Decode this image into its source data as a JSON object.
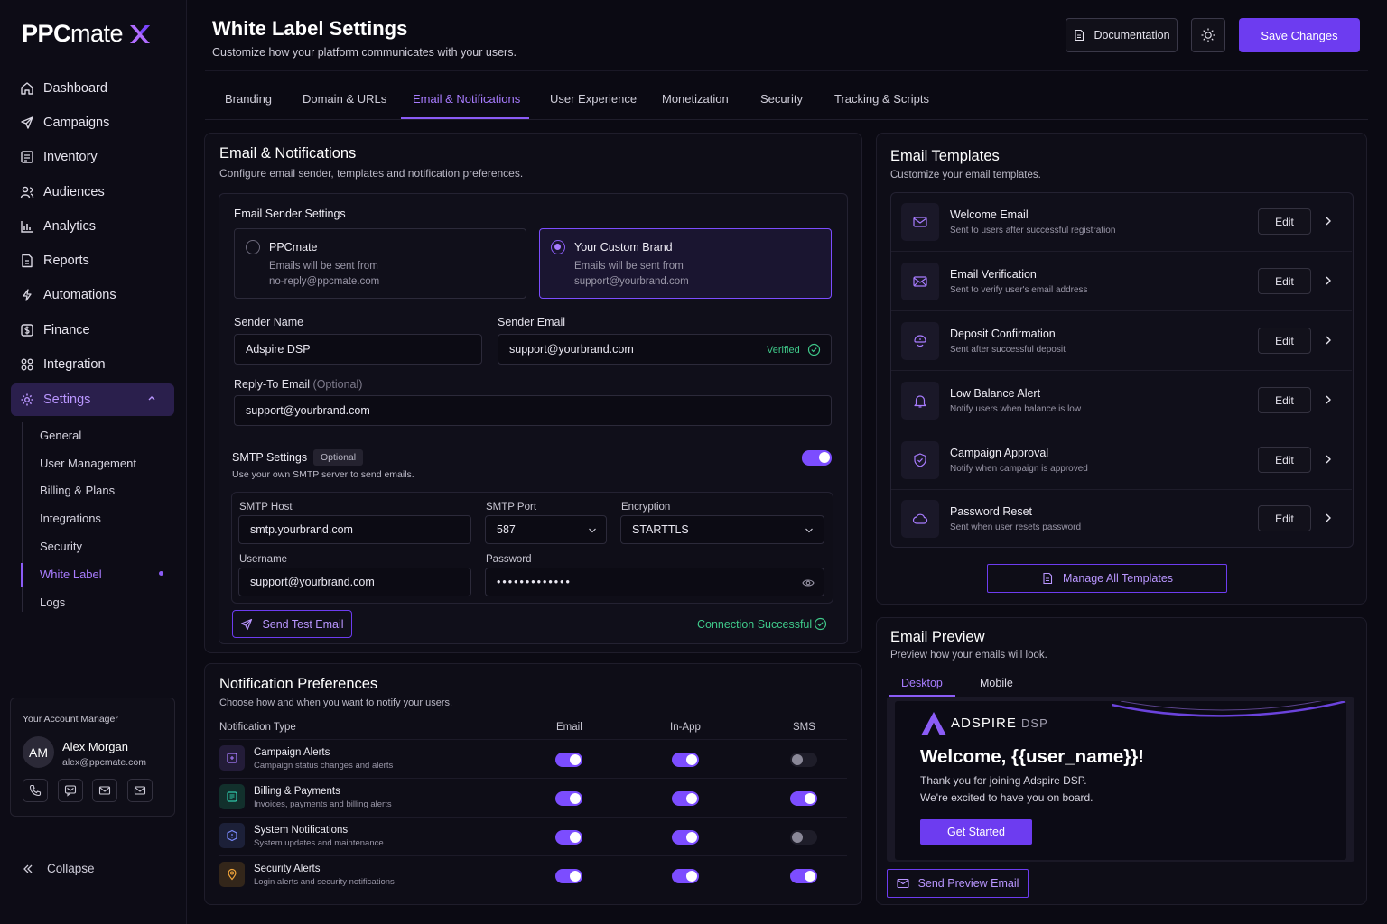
{
  "brand": {
    "logo_main": "PPC",
    "logo_light": "mate",
    "accent": "#7c4dff",
    "mark_color": "#a66cff"
  },
  "sidebar": {
    "nav": [
      {
        "label": "Dashboard",
        "icon": "home-icon"
      },
      {
        "label": "Campaigns",
        "icon": "send-icon"
      },
      {
        "label": "Inventory",
        "icon": "inventory-icon"
      },
      {
        "label": "Audiences",
        "icon": "users-icon"
      },
      {
        "label": "Analytics",
        "icon": "chart-icon"
      },
      {
        "label": "Reports",
        "icon": "file-icon"
      },
      {
        "label": "Automations",
        "icon": "automation-icon"
      },
      {
        "label": "Finance",
        "icon": "dollar-icon"
      },
      {
        "label": "Integration",
        "icon": "integration-icon"
      },
      {
        "label": "Settings",
        "icon": "gear-icon"
      }
    ],
    "sub": [
      "General",
      "User Management",
      "Billing & Plans",
      "Integrations",
      "Security",
      "White Label",
      "Logs"
    ],
    "account": {
      "title": "Your Account Manager",
      "initials": "AM",
      "name": "Alex Morgan",
      "email": "alex@ppcmate.com"
    },
    "collapse": "Collapse"
  },
  "header": {
    "title": "White Label Settings",
    "subtitle": "Customize how your platform communicates with your users.",
    "docs": "Documentation",
    "save": "Save Changes"
  },
  "tabs": [
    "Branding",
    "Domain & URLs",
    "Email & Notifications",
    "User Experience",
    "Monetization",
    "Security",
    "Tracking & Scripts"
  ],
  "email": {
    "title": "Email & Notifications",
    "subtitle": "Configure email sender, templates and notification preferences.",
    "sender_title": "Email Sender Settings",
    "opt1": {
      "name": "PPCmate",
      "line1": "Emails will be sent from",
      "line2": "no-reply@ppcmate.com"
    },
    "opt2": {
      "name": "Your Custom Brand",
      "line1": "Emails will be sent from",
      "line2": "support@yourbrand.com"
    },
    "sender_name_label": "Sender Name",
    "sender_name": "Adspire DSP",
    "sender_email_label": "Sender Email",
    "sender_email": "support@yourbrand.com",
    "verified": "Verified",
    "reply_label": "Reply-To Email",
    "reply_optional": "(Optional)",
    "reply": "support@yourbrand.com",
    "smtp": {
      "title": "SMTP Settings",
      "badge": "Optional",
      "desc": "Use your own SMTP server to send emails.",
      "enabled": true,
      "host_label": "SMTP Host",
      "host": "smtp.yourbrand.com",
      "port_label": "SMTP Port",
      "port": "587",
      "enc_label": "Encryption",
      "enc": "STARTTLS",
      "user_label": "Username",
      "user": "support@yourbrand.com",
      "pass_label": "Password",
      "pass": "•••••••••••••",
      "test": "Send Test Email",
      "status": "Connection Successful"
    }
  },
  "notifications": {
    "title": "Notification Preferences",
    "subtitle": "Choose how and when you want to notify your users.",
    "columns": [
      "Notification Type",
      "Email",
      "In-App",
      "SMS"
    ],
    "rows": [
      {
        "title": "Campaign Alerts",
        "desc": "Campaign status changes and alerts",
        "icon": "campaign-icon",
        "color": "#a87cff",
        "email": true,
        "inapp": true,
        "sms": false
      },
      {
        "title": "Billing & Payments",
        "desc": "Invoices, payments and billing alerts",
        "icon": "billing-icon",
        "color": "#2fc7a9",
        "email": true,
        "inapp": true,
        "sms": true
      },
      {
        "title": "System Notifications",
        "desc": "System updates and maintenance",
        "icon": "system-icon",
        "color": "#7b8cff",
        "email": true,
        "inapp": true,
        "sms": false
      },
      {
        "title": "Security Alerts",
        "desc": "Login alerts and security notifications",
        "icon": "location-icon",
        "color": "#f0a43a",
        "email": true,
        "inapp": true,
        "sms": true
      }
    ]
  },
  "templates": {
    "title": "Email Templates",
    "subtitle": "Customize your email templates.",
    "edit": "Edit",
    "items": [
      {
        "title": "Welcome Email",
        "desc": "Sent to users after successful registration",
        "icon": "mail-icon"
      },
      {
        "title": "Email Verification",
        "desc": "Sent to verify user's email address",
        "icon": "mail-check-icon"
      },
      {
        "title": "Deposit Confirmation",
        "desc": "Sent after successful deposit",
        "icon": "deposit-icon"
      },
      {
        "title": "Low Balance Alert",
        "desc": "Notify users when balance is low",
        "icon": "bell-icon"
      },
      {
        "title": "Campaign Approval",
        "desc": "Notify when campaign is approved",
        "icon": "shield-check-icon"
      },
      {
        "title": "Password Reset",
        "desc": "Sent when user resets password",
        "icon": "cloud-lock-icon"
      }
    ],
    "manage": "Manage All Templates"
  },
  "preview": {
    "title": "Email Preview",
    "subtitle": "Preview how your emails will look.",
    "tabs": [
      "Desktop",
      "Mobile"
    ],
    "brand_main": "ADSPIRE",
    "brand_sub": "DSP",
    "heading": "Welcome, {{user_name}}!",
    "line1": "Thank you for joining Adspire DSP.",
    "line2": "We're excited to have you on board.",
    "cta": "Get Started",
    "send": "Send Preview Email"
  }
}
